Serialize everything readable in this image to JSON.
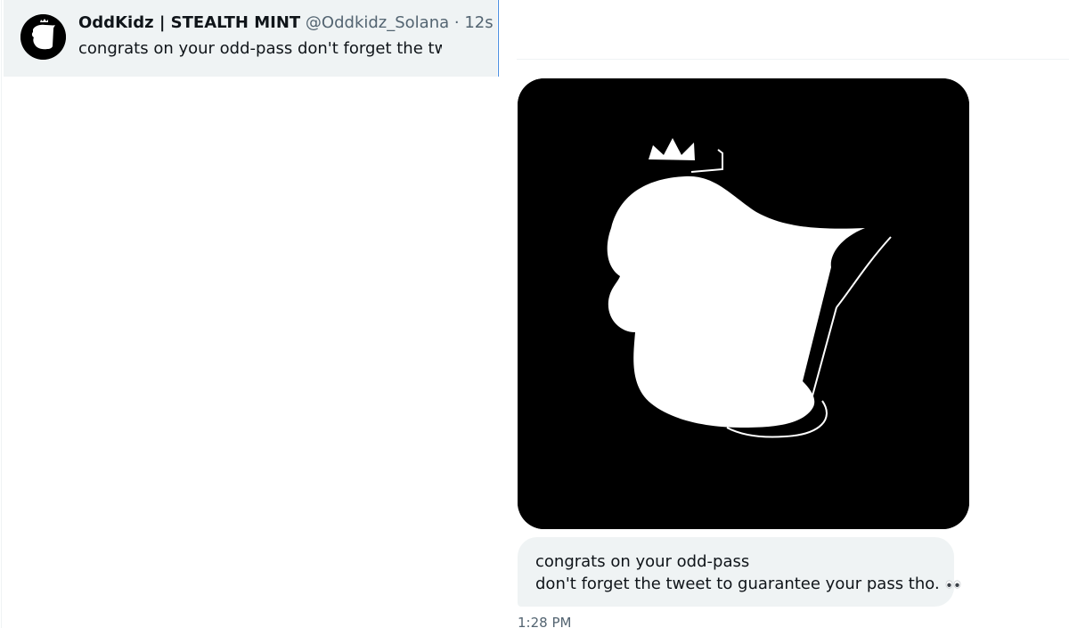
{
  "conversation_list": {
    "items": [
      {
        "display_name": "OddKidz | STEALTH MINT",
        "handle": "@Oddkidz_Solana",
        "separator": "·",
        "time_ago": "12s",
        "preview": "congrats on your odd-pass don't forget the twe",
        "avatar_icon": "oddkidz-logo-icon",
        "selected": true
      }
    ]
  },
  "thread": {
    "media": {
      "icon": "oddkidz-crowned-head-icon",
      "background_color": "#000000"
    },
    "message": {
      "line1": "congrats on your odd-pass",
      "line2": "don't forget the tweet to guarantee your pass tho.",
      "emoji_icon": "eyes-icon",
      "time": "1:28 PM"
    }
  },
  "colors": {
    "selected_row_bg": "#eff3f4",
    "bubble_bg": "#eff3f4",
    "accent_border": "#4a8fe0",
    "secondary_text": "#536471",
    "primary_text": "#0f1419"
  }
}
